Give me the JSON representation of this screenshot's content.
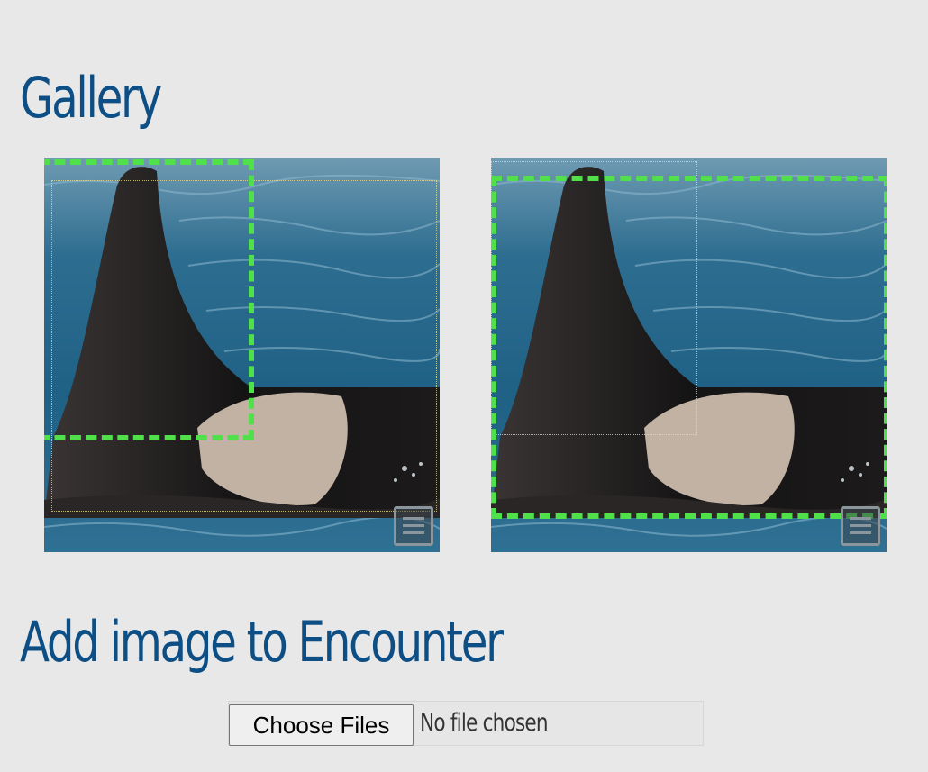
{
  "gallery": {
    "title": "Gallery",
    "images": [
      {
        "alt": "Orca dorsal fin, image 1",
        "menu_icon": "hamburger-menu-icon"
      },
      {
        "alt": "Orca dorsal fin, image 2",
        "menu_icon": "hamburger-menu-icon"
      }
    ]
  },
  "add_image": {
    "title": "Add image to Encounter",
    "choose_label": "Choose Files",
    "status": "No file chosen"
  },
  "colors": {
    "heading": "#0d4f85",
    "active_box": "#4fe04a",
    "background": "#e8e8e8"
  }
}
